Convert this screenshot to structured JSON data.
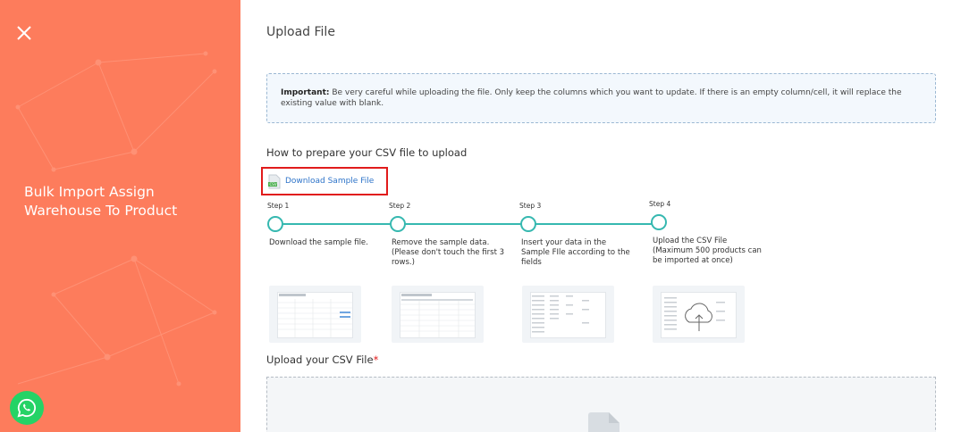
{
  "sidebar": {
    "title": "Bulk Import Assign Warehouse To Product",
    "close_icon": "close-icon",
    "whatsapp_icon": "whatsapp-icon"
  },
  "main": {
    "page_title": "Upload File",
    "notice": {
      "label": "Important:",
      "text": " Be very careful while uploading the file. Only keep the columns which you want to update. If there is an empty column/cell, it will replace the existing value with blank."
    },
    "how_title": "How to prepare your CSV file to upload",
    "download_label": "Download Sample File",
    "steps": [
      {
        "label": "Step 1",
        "desc": "Download the sample file."
      },
      {
        "label": "Step 2",
        "desc": "Remove the sample data. (Please don't touch the first 3 rows.)"
      },
      {
        "label": "Step 3",
        "desc": "Insert your data in the Sample FIle according to the fields"
      },
      {
        "label": "Step 4",
        "desc": "Upload the CSV File (Maximum 500 products can be imported at once)"
      }
    ],
    "upload_title": "Upload your CSV File",
    "required_mark": "*"
  },
  "colors": {
    "panel": "#fd7c5c",
    "accent": "#36b8b0",
    "link": "#2e74c9",
    "highlight": "#e11b1b"
  }
}
